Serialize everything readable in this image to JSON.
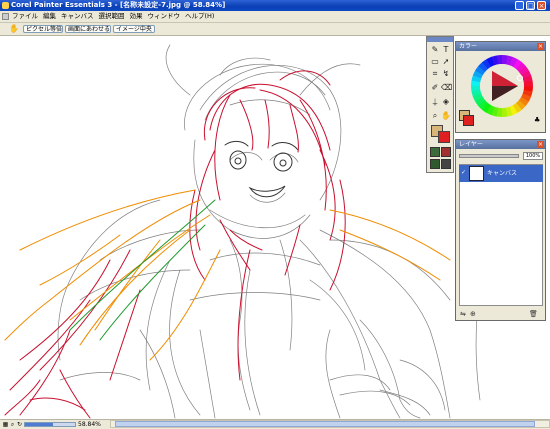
{
  "window": {
    "title": "Corel Painter Essentials 3 - [名称未設定-7.jpg @ 58.84%]",
    "minimize_glyph": "_",
    "maximize_glyph": "□",
    "close_glyph": "×"
  },
  "menubar": {
    "items": [
      "ファイル",
      "編集",
      "キャンバス",
      "選択範囲",
      "効果",
      "ウィンドウ",
      "ヘルプ(H)"
    ]
  },
  "propbar": {
    "buttons": [
      "ピクセル等倍",
      "画面にあわせる",
      "イメージ中央"
    ],
    "grabber_icon": "hand-icon"
  },
  "statusbar": {
    "zoom_text": "58.84%",
    "zoom_fraction": 0.55
  },
  "color_panel": {
    "title": "カラー",
    "main_color": "#d8b67a",
    "additional_color": "#e02020",
    "hue_color": "#e0243a"
  },
  "layers_panel": {
    "title": "レイヤー",
    "opacity_value": "100%",
    "layers": [
      {
        "name": "キャンバス",
        "selected": true
      }
    ]
  },
  "toolbox": {
    "tools": [
      "brush-icon",
      "text-icon",
      "rect-select-icon",
      "lasso-icon",
      "crop-icon",
      "transform-icon",
      "pen-icon",
      "eraser-icon",
      "dropper-icon",
      "paint-bucket-icon",
      "magnifier-icon",
      "hand-tool-icon"
    ]
  },
  "colors": {
    "sketch_red": "#c8102e",
    "sketch_orange": "#f08c00",
    "sketch_green": "#1e9a2e",
    "sketch_gray": "#444444"
  }
}
